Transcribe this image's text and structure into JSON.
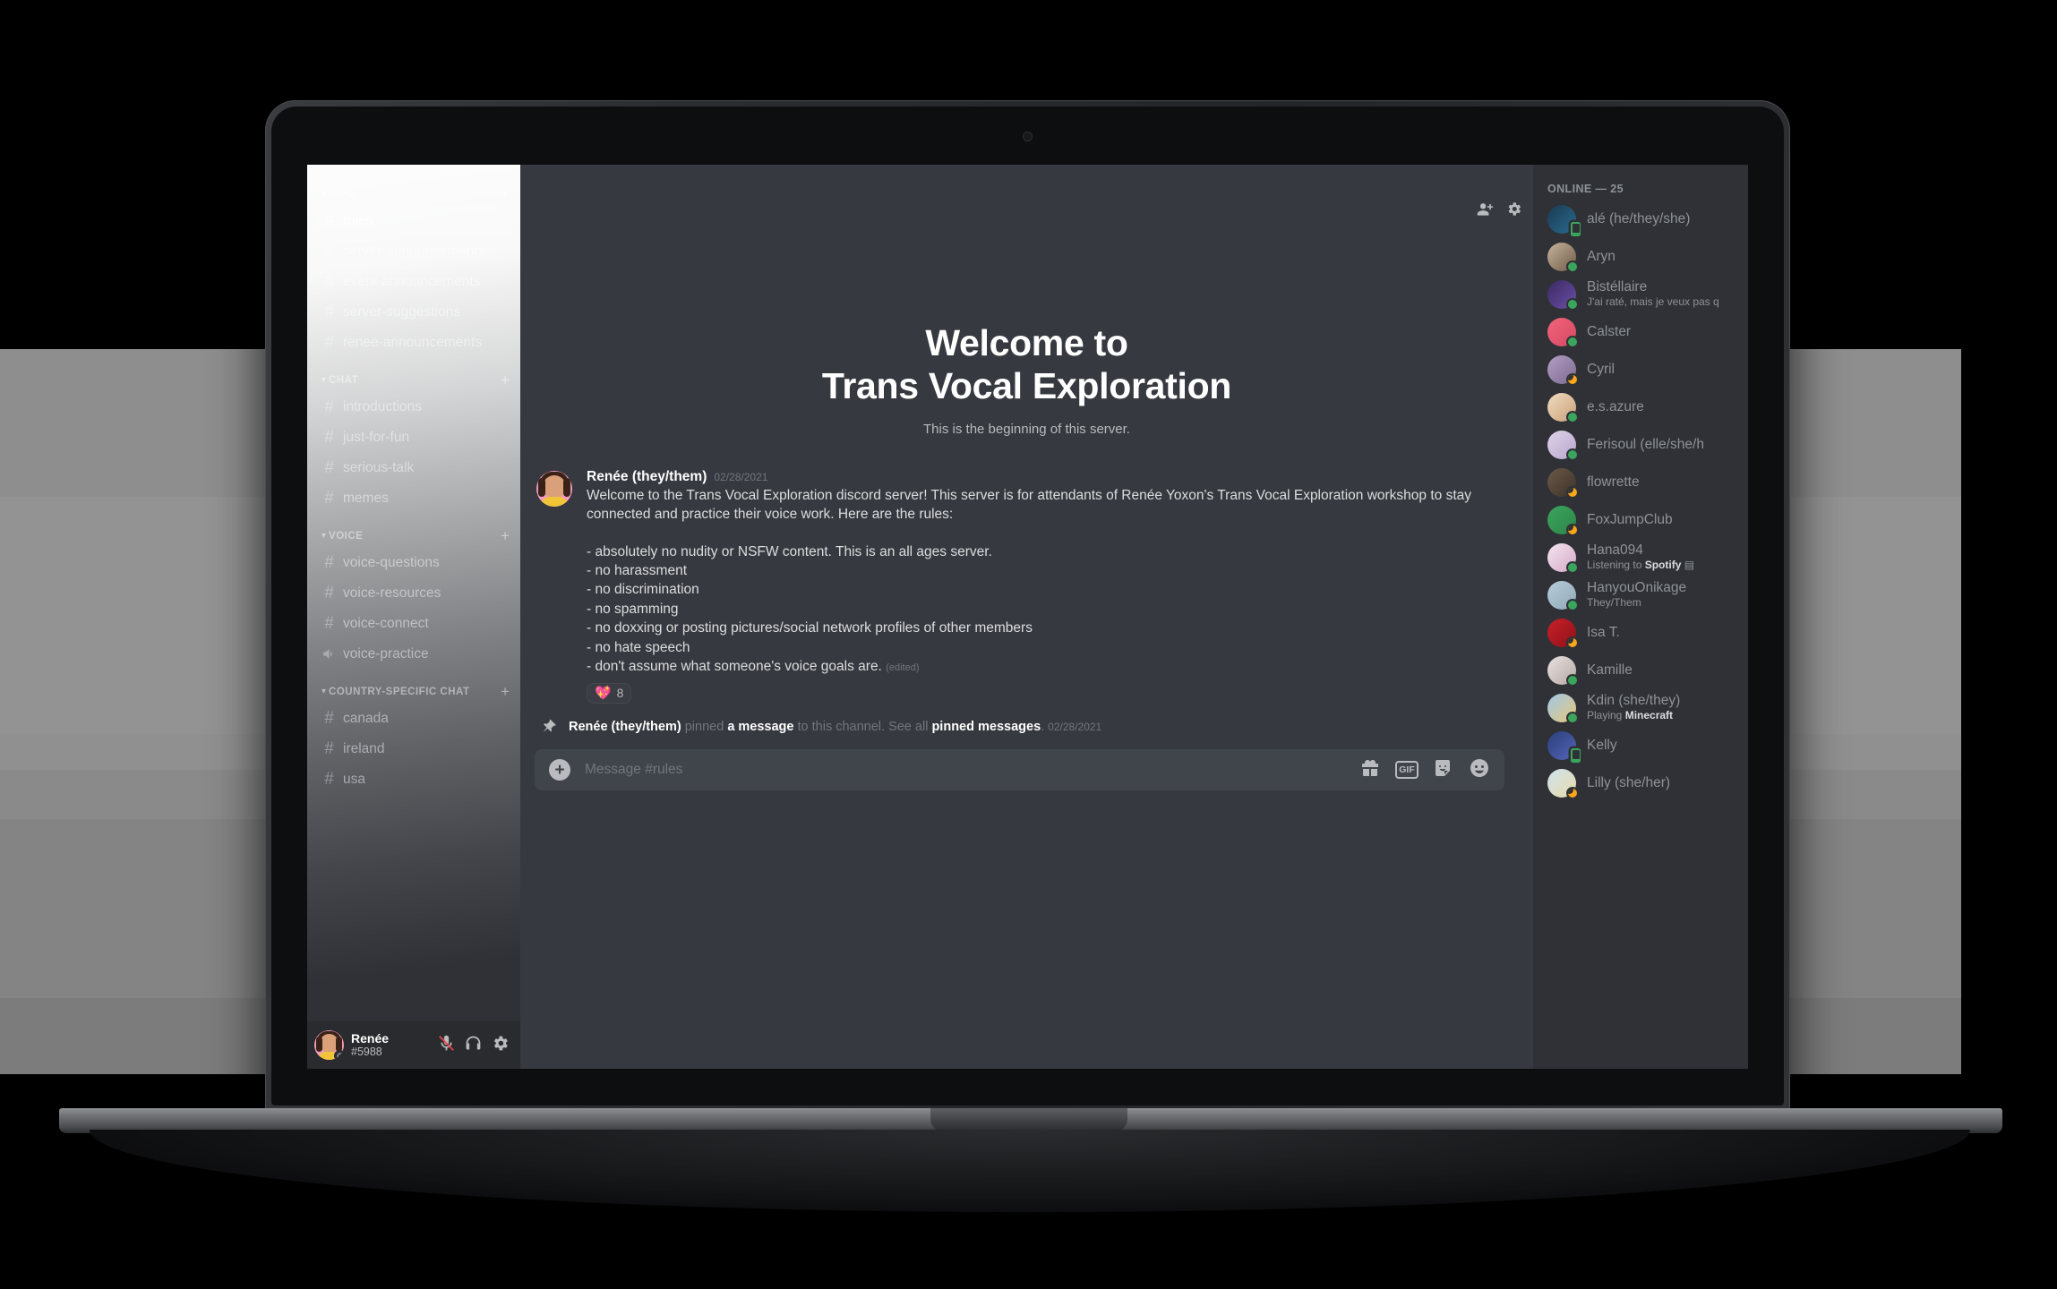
{
  "sidebar": {
    "hidden_categories": [
      {
        "name": "INFO",
        "plus": "+"
      }
    ],
    "top_channels": [
      {
        "name": "rules",
        "icon": "hash",
        "active": true
      },
      {
        "name": "server-announcements",
        "icon": "hash",
        "active": false
      },
      {
        "name": "event-announcements",
        "icon": "hash",
        "active": false
      },
      {
        "name": "server-suggestions",
        "icon": "hash",
        "active": false
      },
      {
        "name": "renee-announcements",
        "icon": "hash",
        "active": false
      }
    ],
    "categories": [
      {
        "name": "CHAT",
        "plus": "+",
        "channels": [
          {
            "name": "introductions",
            "icon": "hash"
          },
          {
            "name": "just-for-fun",
            "icon": "hash"
          },
          {
            "name": "serious-talk",
            "icon": "hash"
          },
          {
            "name": "memes",
            "icon": "hash"
          }
        ]
      },
      {
        "name": "VOICE",
        "plus": "+",
        "channels": [
          {
            "name": "voice-questions",
            "icon": "hash"
          },
          {
            "name": "voice-resources",
            "icon": "hash"
          },
          {
            "name": "voice-connect",
            "icon": "hash"
          },
          {
            "name": "voice-practice",
            "icon": "speaker"
          }
        ]
      },
      {
        "name": "COUNTRY-SPECIFIC CHAT",
        "plus": "+",
        "channels": [
          {
            "name": "canada",
            "icon": "hash"
          },
          {
            "name": "ireland",
            "icon": "hash"
          },
          {
            "name": "usa",
            "icon": "hash"
          }
        ]
      }
    ],
    "user_panel": {
      "name": "Renée",
      "tag": "#5988",
      "mic_icon": "microphone-muted-icon",
      "headset_icon": "headset-icon",
      "settings_icon": "gear-icon"
    }
  },
  "header": {
    "add_member_icon": "add-member-icon",
    "settings_icon": "gear-icon"
  },
  "main": {
    "welcome_line1": "Welcome to",
    "welcome_line2": "Trans Vocal Exploration",
    "welcome_sub": "This is the beginning of this server.",
    "message": {
      "author": "Renée (they/them)",
      "timestamp": "02/28/2021",
      "paragraph": "Welcome to the Trans Vocal Exploration discord server! This server is for attendants of Renée Yoxon's Trans Vocal Exploration workshop to stay connected and practice their voice work. Here are the rules:",
      "rules": [
        "- absolutely no nudity or NSFW content. This is an all ages server.",
        "- no harassment",
        "- no discrimination",
        "- no spamming",
        "- no doxxing or posting pictures/social network profiles of other members",
        "- no hate speech",
        "- don't assume what someone's voice goals are."
      ],
      "edited_label": "(edited)",
      "reaction": {
        "emoji": "💖",
        "count": "8"
      }
    },
    "pinned_notice": {
      "author": "Renée (they/them)",
      "verb": " pinned ",
      "link1": "a message",
      "mid": " to this channel. See all ",
      "link2": "pinned messages",
      "end": ".",
      "timestamp": "02/28/2021",
      "pin_icon": "pin-icon"
    },
    "composer": {
      "placeholder": "Message #rules",
      "plus": "+",
      "gift_icon": "gift-icon",
      "gif_label": "GIF",
      "sticker_icon": "sticker-icon",
      "emoji_icon": "emoji-icon"
    }
  },
  "members": {
    "header": "ONLINE — 25",
    "list": [
      {
        "name": "alé (he/they/she)",
        "sub": "",
        "status": "mobile",
        "av": [
          "#1b3a52",
          "#2a6b8f"
        ]
      },
      {
        "name": "Aryn",
        "sub": "",
        "status": "online",
        "av": [
          "#c8b59e",
          "#6e5a46"
        ]
      },
      {
        "name": "Bistéllaire",
        "sub": "J'ai raté, mais je veux pas q",
        "status": "online",
        "av": [
          "#3a2960",
          "#6b4fa8"
        ]
      },
      {
        "name": "Calster",
        "sub": "",
        "status": "online",
        "av": [
          "#f2637a",
          "#d44a63"
        ]
      },
      {
        "name": "Cyril",
        "sub": "",
        "status": "idle",
        "av": [
          "#b39ec4",
          "#7d6a90"
        ]
      },
      {
        "name": "e.s.azure",
        "sub": "",
        "status": "online",
        "av": [
          "#f0dcc0",
          "#c9a07a"
        ]
      },
      {
        "name": "Ferisoul (elle/she/h",
        "sub": "",
        "status": "online",
        "av": [
          "#ddd3e8",
          "#b9a6cf"
        ]
      },
      {
        "name": "flowrette",
        "sub": "",
        "status": "idle",
        "av": [
          "#6b5a48",
          "#3b3028"
        ]
      },
      {
        "name": "FoxJumpClub",
        "sub": "",
        "status": "idle",
        "av": [
          "#3ba55d",
          "#2e8549"
        ]
      },
      {
        "name": "Hana094",
        "sub_pre": "Listening to ",
        "sub_b": "Spotify",
        "status": "online",
        "av": [
          "#f3e6ef",
          "#d7a8c8"
        ]
      },
      {
        "name": "HanyouOnikage",
        "sub": "They/Them",
        "status": "online",
        "av": [
          "#b9ccd9",
          "#8fa8b8"
        ]
      },
      {
        "name": "Isa T.",
        "sub": "",
        "status": "idle",
        "av": [
          "#c8202a",
          "#8f1118"
        ]
      },
      {
        "name": "Kamille",
        "sub": "",
        "status": "online",
        "av": [
          "#e8e2e0",
          "#b6a8a4"
        ]
      },
      {
        "name": "Kdin (she/they)",
        "sub_pre": "Playing ",
        "sub_b": "Minecraft",
        "status": "online",
        "av": [
          "#9fc8e8",
          "#e8c87a"
        ]
      },
      {
        "name": "Kelly",
        "sub": "",
        "status": "mobile",
        "av": [
          "#2a3e7a",
          "#5566b8"
        ]
      },
      {
        "name": "Lilly (she/her)",
        "sub": "",
        "status": "idle",
        "av": [
          "#cfe3f0",
          "#e8dba8"
        ]
      }
    ]
  }
}
